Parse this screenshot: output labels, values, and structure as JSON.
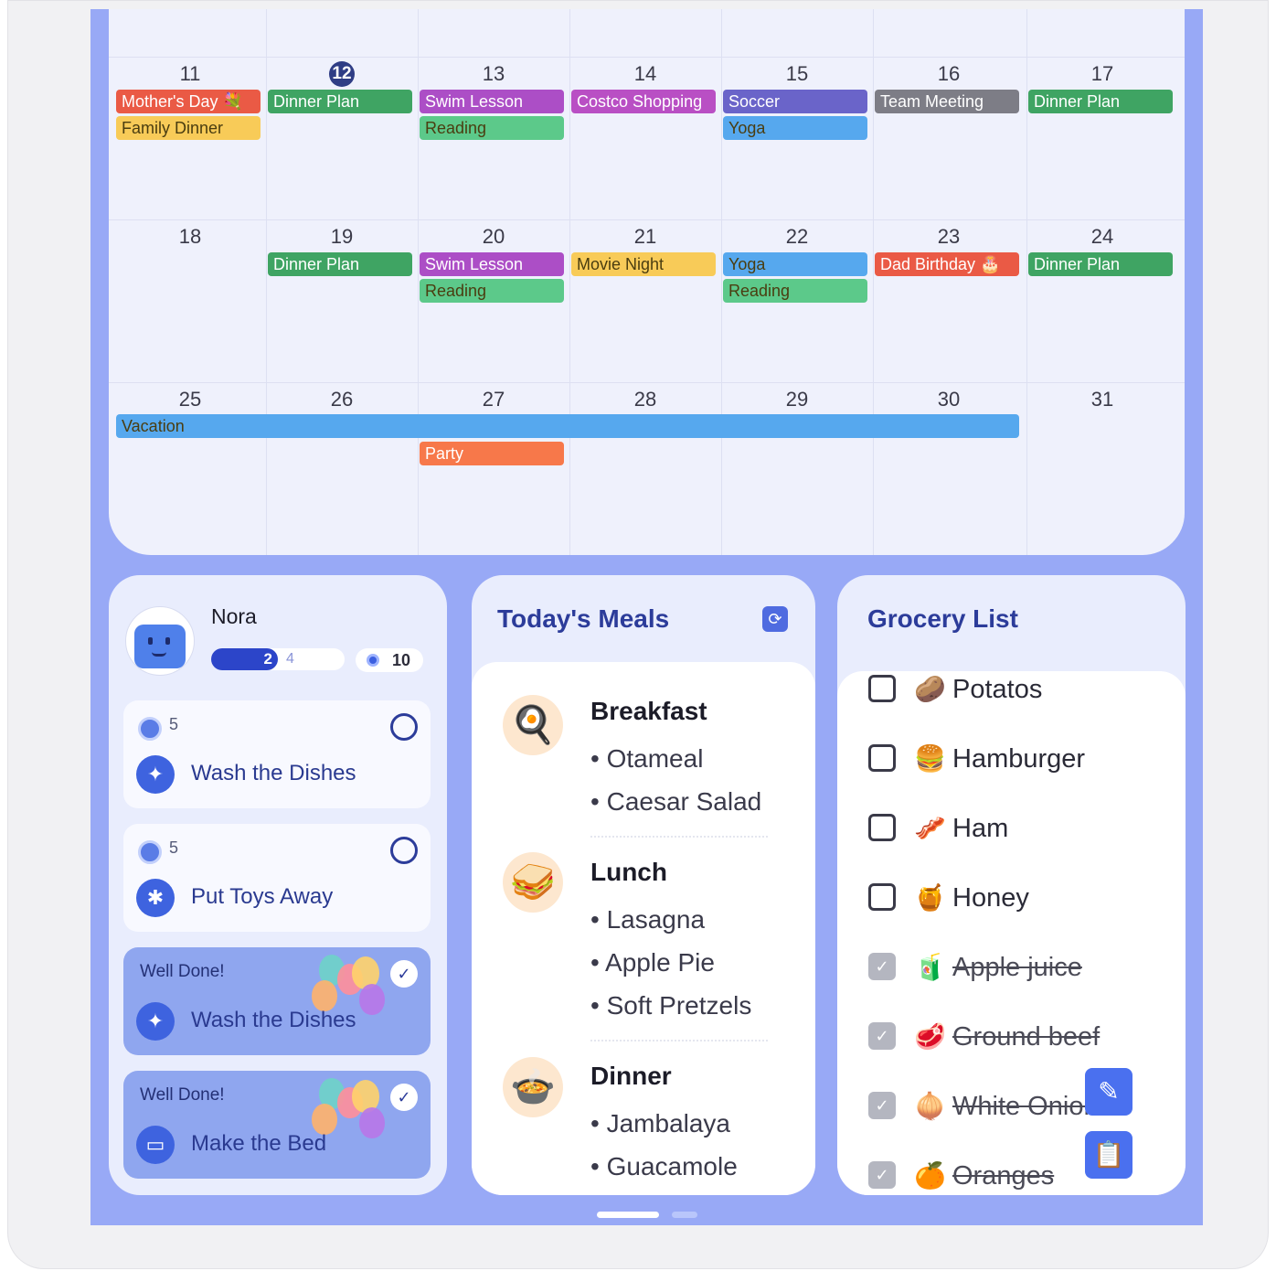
{
  "calendar": {
    "weeks": [
      {
        "days": [
          "11",
          "12",
          "13",
          "14",
          "15",
          "16",
          "17"
        ],
        "today_index": 1
      },
      {
        "days": [
          "18",
          "19",
          "20",
          "21",
          "22",
          "23",
          "24"
        ]
      },
      {
        "days": [
          "25",
          "26",
          "27",
          "28",
          "29",
          "30",
          "31"
        ]
      }
    ],
    "events": [
      {
        "label": "Mother's Day 💐",
        "color": "#ea5a45"
      },
      {
        "label": "Family Dinner",
        "color": "#f8cb58"
      },
      {
        "label": "Dinner Plan",
        "color": "#3fa463"
      },
      {
        "label": "Swim Lesson",
        "color": "#ac4ec6"
      },
      {
        "label": "Reading",
        "color": "#5cc98a"
      },
      {
        "label": "Costco Shopping",
        "color": "#b94fc4"
      },
      {
        "label": "Soccer",
        "color": "#6a64c9"
      },
      {
        "label": "Yoga",
        "color": "#56a8ee"
      },
      {
        "label": "Team Meeting",
        "color": "#7d7d86"
      },
      {
        "label": "Dinner Plan",
        "color": "#3fa463"
      },
      {
        "label": "Dinner Plan",
        "color": "#3fa463"
      },
      {
        "label": "Swim Lesson",
        "color": "#ac4ec6"
      },
      {
        "label": "Reading",
        "color": "#5cc98a"
      },
      {
        "label": "Movie Night",
        "color": "#f8cb58"
      },
      {
        "label": "Yoga",
        "color": "#56a8ee"
      },
      {
        "label": "Reading",
        "color": "#5cc98a"
      },
      {
        "label": "Dad Birthday 🎂",
        "color": "#ea5a45"
      },
      {
        "label": "Dinner Plan",
        "color": "#3fa463"
      },
      {
        "label": "Vacation",
        "color": "#56a8ee"
      },
      {
        "label": "Party",
        "color": "#f7784a"
      }
    ]
  },
  "chores": {
    "user_name": "Nora",
    "progress_done": "2",
    "progress_total": "4",
    "progress_fraction": 0.5,
    "coins": "10",
    "items": [
      {
        "points": "5",
        "name": "Wash the Dishes",
        "done": false
      },
      {
        "points": "5",
        "name": "Put Toys Away",
        "done": false
      },
      {
        "status": "Well Done!",
        "name": "Wash the Dishes",
        "done": true
      },
      {
        "status": "Well Done!",
        "name": "Make the Bed",
        "done": true
      }
    ]
  },
  "meals": {
    "title": "Today's Meals",
    "sections": [
      {
        "name": "Breakfast",
        "emoji": "🍳",
        "items": [
          "Otameal",
          "Caesar Salad"
        ]
      },
      {
        "name": "Lunch",
        "emoji": "🥪",
        "items": [
          "Lasagna",
          "Apple Pie",
          "Soft Pretzels"
        ]
      },
      {
        "name": "Dinner",
        "emoji": "🍲",
        "items": [
          "Jambalaya",
          "Guacamole"
        ]
      }
    ]
  },
  "grocery": {
    "title": "Grocery List",
    "items": [
      {
        "name": "Potatos",
        "emoji": "🥔",
        "checked": false
      },
      {
        "name": "Hamburger",
        "emoji": "🍔",
        "checked": false
      },
      {
        "name": "Ham",
        "emoji": "🥓",
        "checked": false
      },
      {
        "name": "Honey",
        "emoji": "🍯",
        "checked": false
      },
      {
        "name": "Apple juice",
        "emoji": "🧃",
        "checked": true
      },
      {
        "name": "Ground beef",
        "emoji": "🥩",
        "checked": true
      },
      {
        "name": "White Onion",
        "emoji": "🧅",
        "checked": true
      },
      {
        "name": "Oranges",
        "emoji": "🍊",
        "checked": true
      }
    ]
  },
  "icons": {
    "refresh": "refresh-icon",
    "edit": "edit-icon",
    "clipboard": "clipboard-add-icon",
    "check": "✓"
  },
  "colors": {
    "screen_bg": "#98a9f6",
    "accent": "#2c3c9a",
    "button": "#4a70ef"
  }
}
